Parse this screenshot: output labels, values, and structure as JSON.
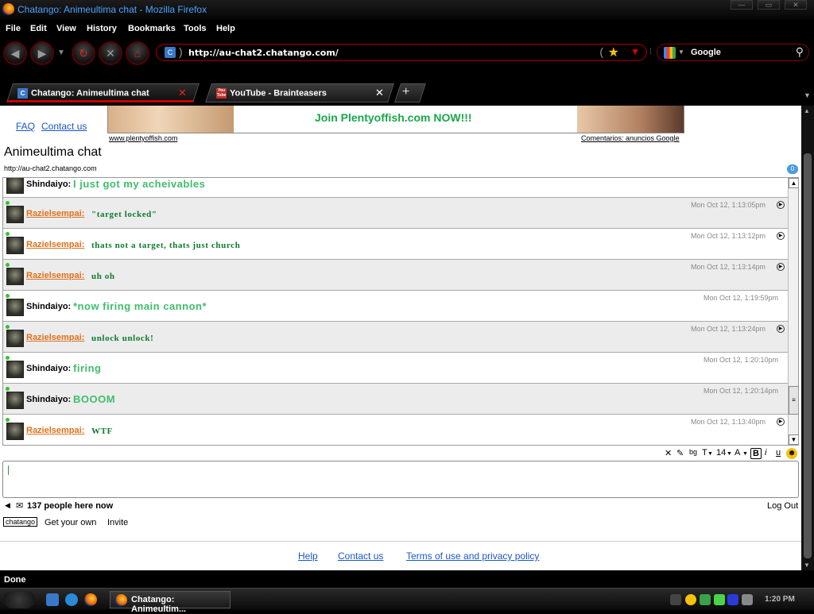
{
  "window": {
    "title": "Chatango: Animeultima chat - Mozilla Firefox"
  },
  "menu": [
    "File",
    "Edit",
    "View",
    "History",
    "Bookmarks",
    "Tools",
    "Help"
  ],
  "nav": {
    "url": "http://au-chat2.chatango.com/",
    "search_engine": "Google"
  },
  "tabs": [
    {
      "label": "Chatango: Animeultima chat",
      "icon": "C"
    },
    {
      "label": "YouTube - Brainteasers",
      "icon": "You Tube"
    }
  ],
  "page": {
    "faq": "FAQ",
    "contact_us": "Contact us",
    "ad": {
      "text": "Join Plentyoffish.com  NOW!!!",
      "left_link": "www.plentyoffish.com",
      "right_link": "Comentarios: anuncios Google"
    },
    "chat_title": "Animeultima chat",
    "chat_url": "http://au-chat2.chatango.com",
    "unread_badge": "0",
    "messages": [
      {
        "user": "Shindaiyo:",
        "text": "I just got my acheivables",
        "time": ""
      },
      {
        "user": "Razielsempai:",
        "text": "\"target locked\"",
        "time": "Mon Oct 12, 1:13:05pm"
      },
      {
        "user": "Razielsempai:",
        "text": "thats not a target, thats just church",
        "time": "Mon Oct 12, 1:13:12pm"
      },
      {
        "user": "Razielsempai:",
        "text": "uh oh",
        "time": "Mon Oct 12, 1:13:14pm"
      },
      {
        "user": "Shindaiyo:",
        "text": "*now firing main cannon*",
        "time": "Mon Oct 12, 1:19:59pm"
      },
      {
        "user": "Razielsempai:",
        "text": "unlock unlock!",
        "time": "Mon Oct 12, 1:13:24pm"
      },
      {
        "user": "Shindaiyo:",
        "text": "firing",
        "time": "Mon Oct 12, 1:20:10pm"
      },
      {
        "user": "Shindaiyo:",
        "text": "BOOOM",
        "time": "Mon Oct 12, 1:20:14pm"
      },
      {
        "user": "Razielsempai:",
        "text": "WTF",
        "time": "Mon Oct 12, 1:13:40pm"
      }
    ],
    "format_bar": {
      "bg": "bg",
      "text": "T",
      "size": "14",
      "bold": "B",
      "italic": "i",
      "underline": "u"
    },
    "people_count": "137 people here now",
    "logout": "Log Out",
    "brand": "chatango",
    "get_your_own": "Get your own",
    "invite": "Invite",
    "footer": {
      "help": "Help",
      "contact": "Contact us",
      "terms": "Terms of use and privacy policy"
    }
  },
  "status": "Done",
  "taskbar": {
    "task_label": "Chatango: Animeultim...",
    "clock": "1:20 PM"
  },
  "colors": {
    "accent_red": "#cc0000",
    "chat_green": "#3dbe6a",
    "dark_green": "#0f7a2e",
    "raziel_orange": "#e0701a",
    "link_blue": "#1a56c9"
  }
}
